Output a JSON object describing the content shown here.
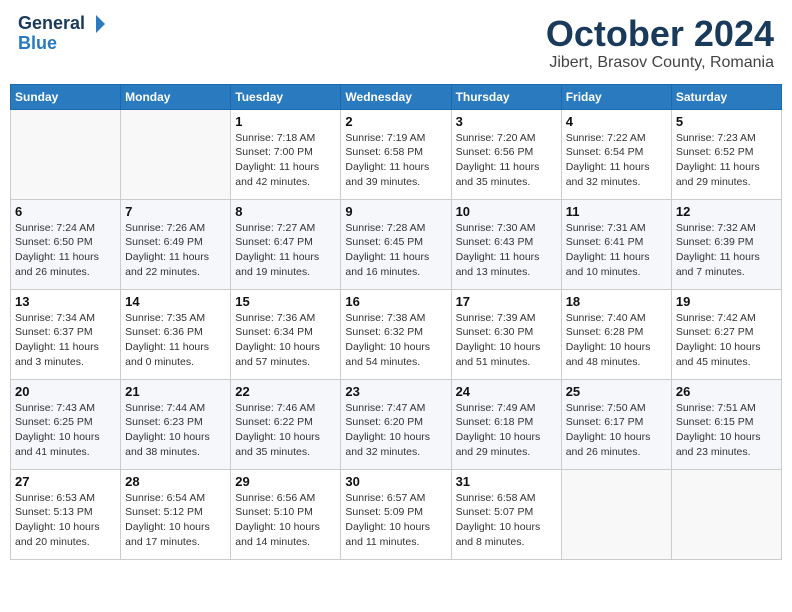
{
  "header": {
    "logo_line1": "General",
    "logo_line2": "Blue",
    "month": "October 2024",
    "location": "Jibert, Brasov County, Romania"
  },
  "weekdays": [
    "Sunday",
    "Monday",
    "Tuesday",
    "Wednesday",
    "Thursday",
    "Friday",
    "Saturday"
  ],
  "weeks": [
    [
      {
        "day": "",
        "empty": true
      },
      {
        "day": "",
        "empty": true
      },
      {
        "day": "1",
        "sunrise": "Sunrise: 7:18 AM",
        "sunset": "Sunset: 7:00 PM",
        "daylight": "Daylight: 11 hours and 42 minutes."
      },
      {
        "day": "2",
        "sunrise": "Sunrise: 7:19 AM",
        "sunset": "Sunset: 6:58 PM",
        "daylight": "Daylight: 11 hours and 39 minutes."
      },
      {
        "day": "3",
        "sunrise": "Sunrise: 7:20 AM",
        "sunset": "Sunset: 6:56 PM",
        "daylight": "Daylight: 11 hours and 35 minutes."
      },
      {
        "day": "4",
        "sunrise": "Sunrise: 7:22 AM",
        "sunset": "Sunset: 6:54 PM",
        "daylight": "Daylight: 11 hours and 32 minutes."
      },
      {
        "day": "5",
        "sunrise": "Sunrise: 7:23 AM",
        "sunset": "Sunset: 6:52 PM",
        "daylight": "Daylight: 11 hours and 29 minutes."
      }
    ],
    [
      {
        "day": "6",
        "sunrise": "Sunrise: 7:24 AM",
        "sunset": "Sunset: 6:50 PM",
        "daylight": "Daylight: 11 hours and 26 minutes."
      },
      {
        "day": "7",
        "sunrise": "Sunrise: 7:26 AM",
        "sunset": "Sunset: 6:49 PM",
        "daylight": "Daylight: 11 hours and 22 minutes."
      },
      {
        "day": "8",
        "sunrise": "Sunrise: 7:27 AM",
        "sunset": "Sunset: 6:47 PM",
        "daylight": "Daylight: 11 hours and 19 minutes."
      },
      {
        "day": "9",
        "sunrise": "Sunrise: 7:28 AM",
        "sunset": "Sunset: 6:45 PM",
        "daylight": "Daylight: 11 hours and 16 minutes."
      },
      {
        "day": "10",
        "sunrise": "Sunrise: 7:30 AM",
        "sunset": "Sunset: 6:43 PM",
        "daylight": "Daylight: 11 hours and 13 minutes."
      },
      {
        "day": "11",
        "sunrise": "Sunrise: 7:31 AM",
        "sunset": "Sunset: 6:41 PM",
        "daylight": "Daylight: 11 hours and 10 minutes."
      },
      {
        "day": "12",
        "sunrise": "Sunrise: 7:32 AM",
        "sunset": "Sunset: 6:39 PM",
        "daylight": "Daylight: 11 hours and 7 minutes."
      }
    ],
    [
      {
        "day": "13",
        "sunrise": "Sunrise: 7:34 AM",
        "sunset": "Sunset: 6:37 PM",
        "daylight": "Daylight: 11 hours and 3 minutes."
      },
      {
        "day": "14",
        "sunrise": "Sunrise: 7:35 AM",
        "sunset": "Sunset: 6:36 PM",
        "daylight": "Daylight: 11 hours and 0 minutes."
      },
      {
        "day": "15",
        "sunrise": "Sunrise: 7:36 AM",
        "sunset": "Sunset: 6:34 PM",
        "daylight": "Daylight: 10 hours and 57 minutes."
      },
      {
        "day": "16",
        "sunrise": "Sunrise: 7:38 AM",
        "sunset": "Sunset: 6:32 PM",
        "daylight": "Daylight: 10 hours and 54 minutes."
      },
      {
        "day": "17",
        "sunrise": "Sunrise: 7:39 AM",
        "sunset": "Sunset: 6:30 PM",
        "daylight": "Daylight: 10 hours and 51 minutes."
      },
      {
        "day": "18",
        "sunrise": "Sunrise: 7:40 AM",
        "sunset": "Sunset: 6:28 PM",
        "daylight": "Daylight: 10 hours and 48 minutes."
      },
      {
        "day": "19",
        "sunrise": "Sunrise: 7:42 AM",
        "sunset": "Sunset: 6:27 PM",
        "daylight": "Daylight: 10 hours and 45 minutes."
      }
    ],
    [
      {
        "day": "20",
        "sunrise": "Sunrise: 7:43 AM",
        "sunset": "Sunset: 6:25 PM",
        "daylight": "Daylight: 10 hours and 41 minutes."
      },
      {
        "day": "21",
        "sunrise": "Sunrise: 7:44 AM",
        "sunset": "Sunset: 6:23 PM",
        "daylight": "Daylight: 10 hours and 38 minutes."
      },
      {
        "day": "22",
        "sunrise": "Sunrise: 7:46 AM",
        "sunset": "Sunset: 6:22 PM",
        "daylight": "Daylight: 10 hours and 35 minutes."
      },
      {
        "day": "23",
        "sunrise": "Sunrise: 7:47 AM",
        "sunset": "Sunset: 6:20 PM",
        "daylight": "Daylight: 10 hours and 32 minutes."
      },
      {
        "day": "24",
        "sunrise": "Sunrise: 7:49 AM",
        "sunset": "Sunset: 6:18 PM",
        "daylight": "Daylight: 10 hours and 29 minutes."
      },
      {
        "day": "25",
        "sunrise": "Sunrise: 7:50 AM",
        "sunset": "Sunset: 6:17 PM",
        "daylight": "Daylight: 10 hours and 26 minutes."
      },
      {
        "day": "26",
        "sunrise": "Sunrise: 7:51 AM",
        "sunset": "Sunset: 6:15 PM",
        "daylight": "Daylight: 10 hours and 23 minutes."
      }
    ],
    [
      {
        "day": "27",
        "sunrise": "Sunrise: 6:53 AM",
        "sunset": "Sunset: 5:13 PM",
        "daylight": "Daylight: 10 hours and 20 minutes."
      },
      {
        "day": "28",
        "sunrise": "Sunrise: 6:54 AM",
        "sunset": "Sunset: 5:12 PM",
        "daylight": "Daylight: 10 hours and 17 minutes."
      },
      {
        "day": "29",
        "sunrise": "Sunrise: 6:56 AM",
        "sunset": "Sunset: 5:10 PM",
        "daylight": "Daylight: 10 hours and 14 minutes."
      },
      {
        "day": "30",
        "sunrise": "Sunrise: 6:57 AM",
        "sunset": "Sunset: 5:09 PM",
        "daylight": "Daylight: 10 hours and 11 minutes."
      },
      {
        "day": "31",
        "sunrise": "Sunrise: 6:58 AM",
        "sunset": "Sunset: 5:07 PM",
        "daylight": "Daylight: 10 hours and 8 minutes."
      },
      {
        "day": "",
        "empty": true
      },
      {
        "day": "",
        "empty": true
      }
    ]
  ]
}
